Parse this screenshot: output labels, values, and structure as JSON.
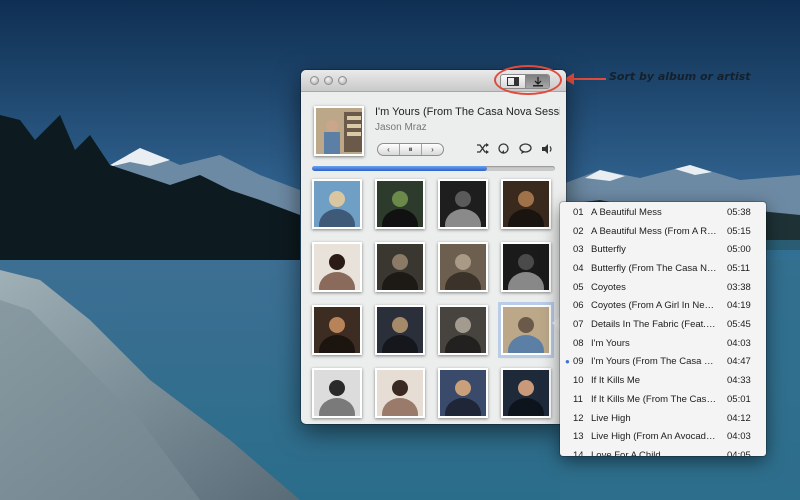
{
  "annotation": {
    "text": "Sort by album or artist"
  },
  "window": {
    "view_buttons": [
      {
        "icon": "album-view-icon",
        "active": false
      },
      {
        "icon": "artist-view-icon",
        "active": true
      }
    ]
  },
  "now_playing": {
    "title": "I'm Yours (From The Casa Nova Sessions)",
    "artist": "Jason Mraz",
    "progress": 0.72,
    "transport": {
      "prev": "‹",
      "pause": "⏸",
      "next": "›"
    },
    "controls": [
      "shuffle-icon",
      "repeat-icon",
      "chat-icon",
      "volume-icon"
    ]
  },
  "albums": [
    {
      "icon": "album-cover-1"
    },
    {
      "icon": "album-cover-2"
    },
    {
      "icon": "album-cover-3"
    },
    {
      "icon": "album-cover-4"
    },
    {
      "icon": "album-cover-5"
    },
    {
      "icon": "album-cover-6"
    },
    {
      "icon": "album-cover-7"
    },
    {
      "icon": "album-cover-8"
    },
    {
      "icon": "album-cover-9"
    },
    {
      "icon": "album-cover-10"
    },
    {
      "icon": "album-cover-11"
    },
    {
      "icon": "album-cover-12",
      "selected": true
    },
    {
      "icon": "album-cover-13"
    },
    {
      "icon": "album-cover-14"
    },
    {
      "icon": "album-cover-15"
    },
    {
      "icon": "album-cover-16"
    }
  ],
  "songs": [
    {
      "no": "01",
      "name": "A Beautiful Mess",
      "dur": "05:38"
    },
    {
      "no": "02",
      "name": "A Beautiful Mess (From A Ra...",
      "dur": "05:15"
    },
    {
      "no": "03",
      "name": "Butterfly",
      "dur": "05:00"
    },
    {
      "no": "04",
      "name": "Butterfly (From The Casa No...",
      "dur": "05:11"
    },
    {
      "no": "05",
      "name": "Coyotes",
      "dur": "03:38"
    },
    {
      "no": "06",
      "name": "Coyotes (From A Girl In New...",
      "dur": "04:19"
    },
    {
      "no": "07",
      "name": "Details In The Fabric (Feat. J...",
      "dur": "05:45"
    },
    {
      "no": "08",
      "name": "I'm Yours",
      "dur": "04:03"
    },
    {
      "no": "09",
      "name": "I'm Yours (From The Casa N...",
      "dur": "04:47",
      "playing": true
    },
    {
      "no": "10",
      "name": "If It Kills Me",
      "dur": "04:33"
    },
    {
      "no": "11",
      "name": "If It Kills Me (From The Casa...",
      "dur": "05:01"
    },
    {
      "no": "12",
      "name": "Live High",
      "dur": "04:12"
    },
    {
      "no": "13",
      "name": "Live High (From An Avocado...",
      "dur": "04:03"
    },
    {
      "no": "14",
      "name": "Love For A Child",
      "dur": "04:05"
    }
  ],
  "colors": {
    "accent": "#3b73d5",
    "annotation": "#e24b3b"
  }
}
